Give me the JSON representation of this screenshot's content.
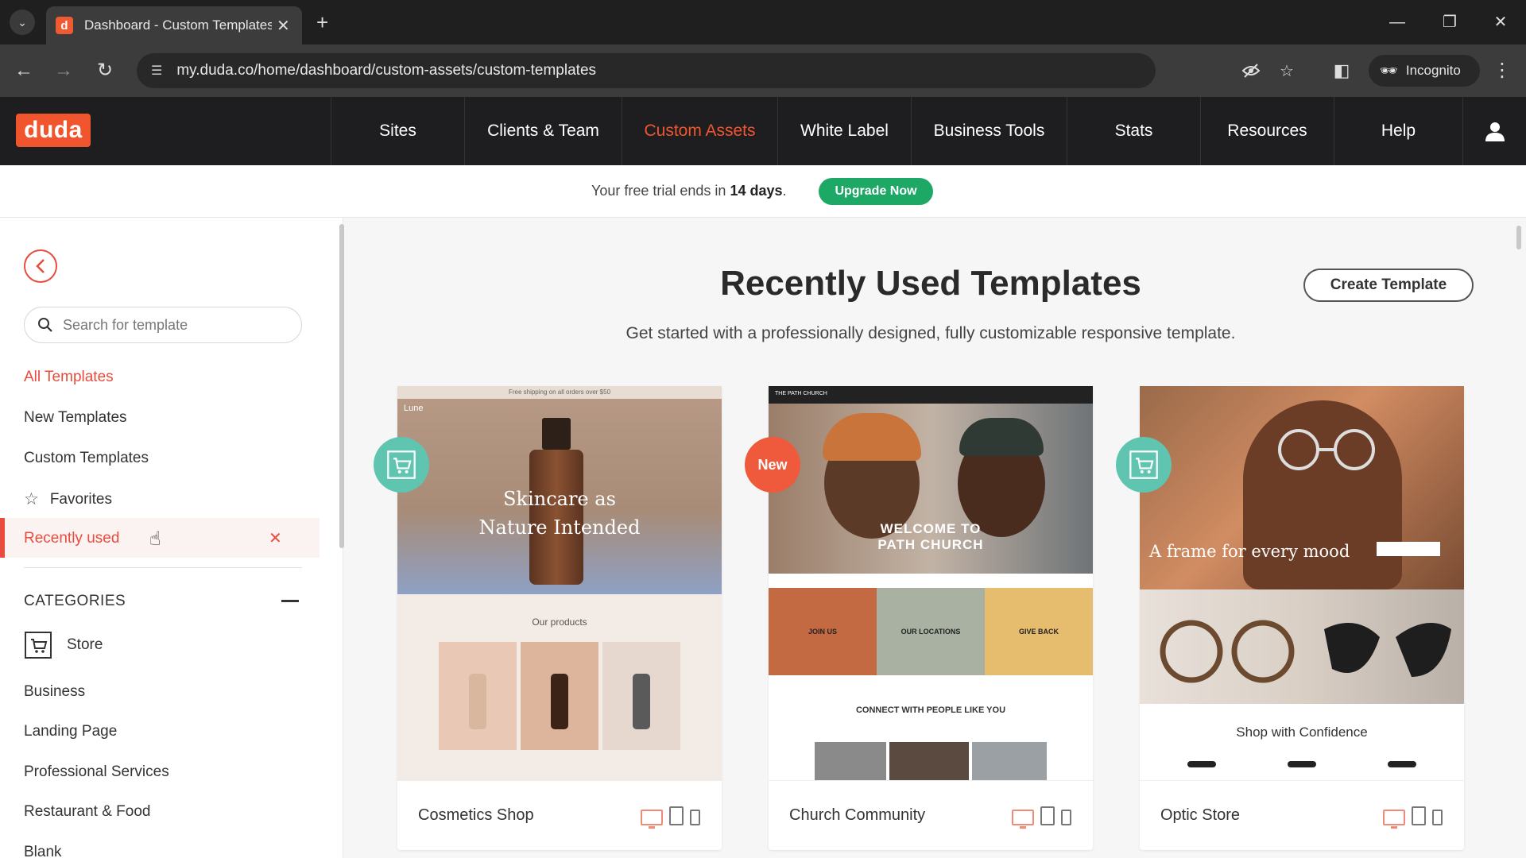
{
  "browser": {
    "tab_title": "Dashboard - Custom Templates",
    "url": "my.duda.co/home/dashboard/custom-assets/custom-templates",
    "incognito_label": "Incognito"
  },
  "header": {
    "logo": "duda",
    "nav": [
      {
        "label": "Sites"
      },
      {
        "label": "Clients & Team"
      },
      {
        "label": "Custom Assets",
        "active": true
      },
      {
        "label": "White Label"
      },
      {
        "label": "Business Tools"
      },
      {
        "label": "Stats"
      },
      {
        "label": "Resources"
      },
      {
        "label": "Help"
      }
    ]
  },
  "trial": {
    "prefix": "Your free trial ends in ",
    "days": "14 days",
    "suffix": ".",
    "upgrade_label": "Upgrade Now"
  },
  "sidebar": {
    "search_placeholder": "Search for template",
    "links": {
      "all": "All Templates",
      "new": "New Templates",
      "custom": "Custom Templates",
      "favorites": "Favorites",
      "recent": "Recently used"
    },
    "categories_heading": "CATEGORIES",
    "categories": {
      "store": "Store",
      "business": "Business",
      "landing": "Landing Page",
      "professional": "Professional Services",
      "restaurant": "Restaurant & Food",
      "blank": "Blank"
    }
  },
  "main": {
    "title": "Recently Used Templates",
    "subtitle": "Get started with a professionally designed, fully customizable responsive template.",
    "create_label": "Create Template",
    "cards": [
      {
        "name": "Cosmetics Shop",
        "badge": "store-icon",
        "preview": {
          "strip": "Free shipping on all orders over $50",
          "brand": "Lune",
          "headline_1": "Skincare as",
          "headline_2": "Nature Intended",
          "section_title": "Our products"
        }
      },
      {
        "name": "Church Community",
        "badge": "New",
        "preview": {
          "brand": "THE PATH CHURCH",
          "headline_1": "WELCOME TO",
          "headline_2": "PATH CHURCH",
          "tile_1": "JOIN US",
          "tile_2": "OUR LOCATIONS",
          "tile_3": "GIVE BACK",
          "connect": "CONNECT WITH PEOPLE LIKE YOU"
        }
      },
      {
        "name": "Optic Store",
        "badge": "store-icon",
        "preview": {
          "headline": "A frame for every mood",
          "section_title": "Shop with Confidence"
        }
      }
    ]
  },
  "colors": {
    "brand": "#f1552d",
    "accent_red": "#e94b3c",
    "upgrade_green": "#1da865",
    "store_badge": "#5fc4b0"
  }
}
